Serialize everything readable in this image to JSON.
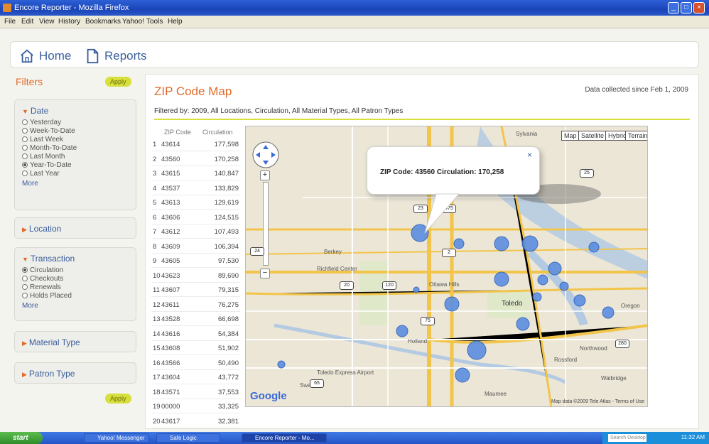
{
  "window": {
    "title": "Encore Reporter - Mozilla Firefox",
    "menu": [
      "File",
      "Edit",
      "View",
      "History",
      "Bookmarks",
      "Yahoo!",
      "Tools",
      "Help"
    ],
    "controls": {
      "minimize": "_",
      "maximize": "□",
      "close": "×"
    }
  },
  "nav": {
    "home": "Home",
    "reports": "Reports"
  },
  "filters": {
    "title": "Filters",
    "apply": "Apply",
    "date": {
      "label": "Date",
      "options": [
        "Yesterday",
        "Week-To-Date",
        "Last Week",
        "Month-To-Date",
        "Last Month",
        "Year-To-Date",
        "Last Year"
      ],
      "selected": "Year-To-Date",
      "more": "More"
    },
    "location": {
      "label": "Location"
    },
    "transaction": {
      "label": "Transaction",
      "options": [
        "Circulation",
        "Checkouts",
        "Renewals",
        "Holds Placed"
      ],
      "selected": "Circulation",
      "more": "More"
    },
    "material": {
      "label": "Material Type"
    },
    "patron": {
      "label": "Patron Type"
    }
  },
  "main": {
    "title": "ZIP Code Map",
    "collected": "Data collected since Feb 1, 2009",
    "filtered_by": "Filtered by: 2009, All Locations, Circulation, All Material Types, All Patron Types"
  },
  "table": {
    "headers": [
      "ZIP Code",
      "Circulation"
    ],
    "rows": [
      {
        "rank": "1",
        "zip": "43614",
        "circ": "177,598"
      },
      {
        "rank": "2",
        "zip": "43560",
        "circ": "170,258"
      },
      {
        "rank": "3",
        "zip": "43615",
        "circ": "140,847"
      },
      {
        "rank": "4",
        "zip": "43537",
        "circ": "133,829"
      },
      {
        "rank": "5",
        "zip": "43613",
        "circ": "129,619"
      },
      {
        "rank": "6",
        "zip": "43606",
        "circ": "124,515"
      },
      {
        "rank": "7",
        "zip": "43612",
        "circ": "107,493"
      },
      {
        "rank": "8",
        "zip": "43609",
        "circ": "106,394"
      },
      {
        "rank": "9",
        "zip": "43605",
        "circ": "97,530"
      },
      {
        "rank": "10",
        "zip": "43623",
        "circ": "89,690"
      },
      {
        "rank": "11",
        "zip": "43607",
        "circ": "79,315"
      },
      {
        "rank": "12",
        "zip": "43611",
        "circ": "76,275"
      },
      {
        "rank": "13",
        "zip": "43528",
        "circ": "66,698"
      },
      {
        "rank": "14",
        "zip": "43616",
        "circ": "54,384"
      },
      {
        "rank": "15",
        "zip": "43608",
        "circ": "51,902"
      },
      {
        "rank": "16",
        "zip": "43566",
        "circ": "50,490"
      },
      {
        "rank": "17",
        "zip": "43604",
        "circ": "43,772"
      },
      {
        "rank": "18",
        "zip": "43571",
        "circ": "37,553"
      },
      {
        "rank": "19",
        "zip": "00000",
        "circ": "33,325"
      },
      {
        "rank": "20",
        "zip": "43617",
        "circ": "32,381"
      }
    ]
  },
  "map": {
    "types": [
      "Map",
      "Satellite",
      "Hybrid",
      "Terrain"
    ],
    "popup": "ZIP Code: 43560 Circulation: 170,258",
    "close": "×",
    "labels": [
      "Toledo",
      "Maumee",
      "Oregon",
      "Ottawa Hills",
      "Sylvania",
      "Holland",
      "Rossford",
      "Walbridge",
      "Northwood",
      "Berkey",
      "Richfield Center",
      "Toledo Express Airport",
      "Swanton"
    ],
    "routes": [
      "23",
      "475",
      "2",
      "20",
      "120",
      "25",
      "280",
      "65",
      "24",
      "75"
    ],
    "logo": "Google",
    "attribution": "Map data ©2009 Tele Atlas - Terms of Use"
  },
  "taskbar": {
    "start": "start",
    "tasks": [
      "Yahoo! Messenger",
      "Safe Logic",
      "Encore Reporter - Mo..."
    ],
    "search": "Search Desktop",
    "clock": "11:32 AM"
  }
}
